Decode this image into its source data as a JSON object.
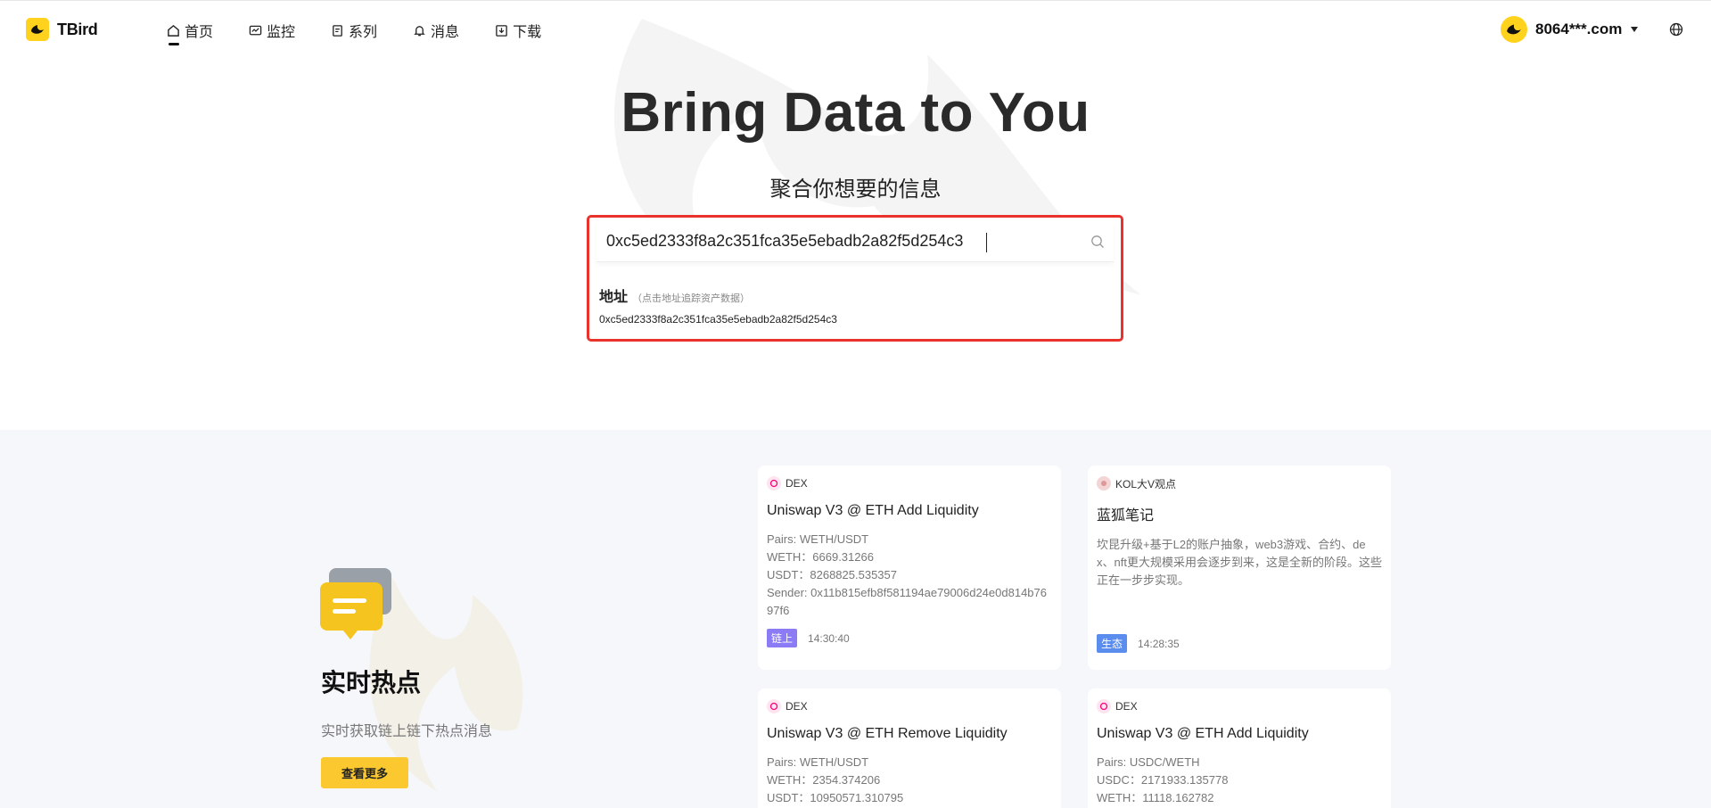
{
  "app": {
    "name": "TBird"
  },
  "nav": [
    {
      "label": "首页",
      "icon": "home-icon"
    },
    {
      "label": "监控",
      "icon": "monitor-icon"
    },
    {
      "label": "系列",
      "icon": "series-icon"
    },
    {
      "label": "消息",
      "icon": "bell-icon"
    },
    {
      "label": "下载",
      "icon": "download-icon"
    }
  ],
  "user": {
    "name": "8064***.com"
  },
  "hero": {
    "title": "Bring Data to You",
    "subtitle": "聚合你想要的信息"
  },
  "search": {
    "value": "0xc5ed2333f8a2c351fca35e5ebadb2a82f5d254c3",
    "suggestion_title": "地址",
    "suggestion_hint": "（点击地址追踪资产数据）",
    "suggestion_address": "0xc5ed2333f8a2c351fca35e5ebadb2a82f5d254c3"
  },
  "hot": {
    "title": "实时热点",
    "subtitle": "实时获取链上链下热点消息",
    "more_label": "查看更多"
  },
  "cards": [
    {
      "tag": "DEX",
      "title": "Uniswap V3 @ ETH Add Liquidity",
      "lines": [
        "Pairs: WETH/USDT",
        "WETH：6669.31266",
        "USDT：8268825.535357",
        "Sender: 0x11b815efb8f581194ae79006d24e0d814b7697f6"
      ],
      "badge": "链上",
      "time": "14:30:40"
    },
    {
      "tag": "KOL大V观点",
      "title": "蓝狐笔记",
      "lines": [
        "坎昆升级+基于L2的账户抽象，web3游戏、合约、dex、nft更大规模采用会逐步到来，这是全新的阶段。这些正在一步步实现。"
      ],
      "badge": "生态",
      "time": "14:28:35"
    },
    {
      "tag": "DEX",
      "title": "Uniswap V3 @ ETH Remove Liquidity",
      "lines": [
        "Pairs: WETH/USDT",
        "WETH：2354.374206",
        "USDT：10950571.310795"
      ]
    },
    {
      "tag": "DEX",
      "title": "Uniswap V3 @ ETH Add Liquidity",
      "lines": [
        "Pairs: USDC/WETH",
        "USDC：2171933.135778",
        "WETH：11118.162782"
      ]
    }
  ],
  "colors": {
    "brand": "#ffd21e",
    "highlight_border": "#e8322c",
    "button": "#fbc82f",
    "badge_onchain": "#8b7cf6",
    "badge_eco": "#5b8def"
  }
}
